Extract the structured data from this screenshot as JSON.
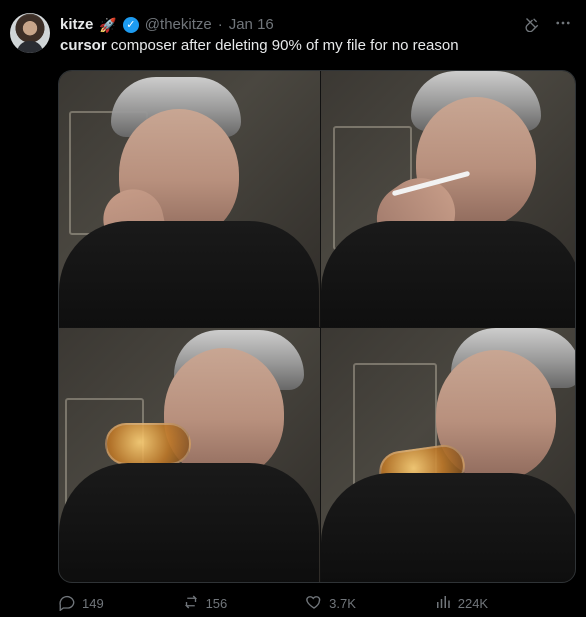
{
  "tweet": {
    "author": {
      "display_name": "kitze",
      "emoji": "🚀",
      "verified_glyph": "✓",
      "handle": "@thekitze",
      "dot": "·",
      "date": "Jan 16"
    },
    "text_strong": "cursor",
    "text_rest": " composer after deleting 90% of my file for no reason",
    "icons": {
      "grok": "grok-icon",
      "more": "more-icon"
    },
    "actions": {
      "replies": "149",
      "reposts": "156",
      "likes": "3.7K",
      "views": "224K"
    }
  }
}
